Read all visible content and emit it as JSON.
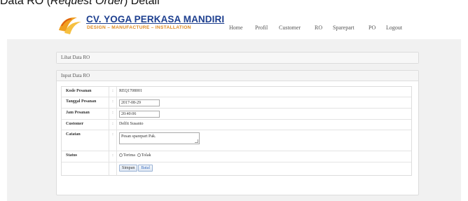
{
  "caption": {
    "prefix": "Data RO (",
    "italic": "Request Order",
    "suffix": ") Detail"
  },
  "brand": {
    "title": "CV. YOGA PERKASA MANDIRI",
    "subtitle": "DESIGN – MANUFACTURE – INSTALLATION"
  },
  "nav": [
    "Home",
    "Profil",
    "Customer",
    "RO",
    "Sparepart",
    "PO",
    "Logout"
  ],
  "panels": {
    "lihat": "Lihat Data RO",
    "input": "Input Data RO"
  },
  "form": {
    "kode": {
      "label": "Kode Pesanan",
      "value": "REQ1708001"
    },
    "tanggal": {
      "label": "Tanggal Pesanan",
      "value": "2017-08-29"
    },
    "jam": {
      "label": "Jam Pesanan",
      "value": "20:40:06"
    },
    "customer": {
      "label": "Customer",
      "value": "Delfit Susanto"
    },
    "catatan": {
      "label": "Catatan",
      "value": "Pesan sparepart Pak."
    },
    "status": {
      "label": "Status",
      "options": [
        "Terima",
        "Tolak"
      ]
    },
    "colon": ":",
    "buttons": {
      "simpan": "Simpan",
      "batal": "Batal"
    }
  },
  "colors": {
    "brand_blue": "#1d3f8f",
    "brand_orange": "#e08a1e",
    "page_bg": "#f1f1f1"
  }
}
